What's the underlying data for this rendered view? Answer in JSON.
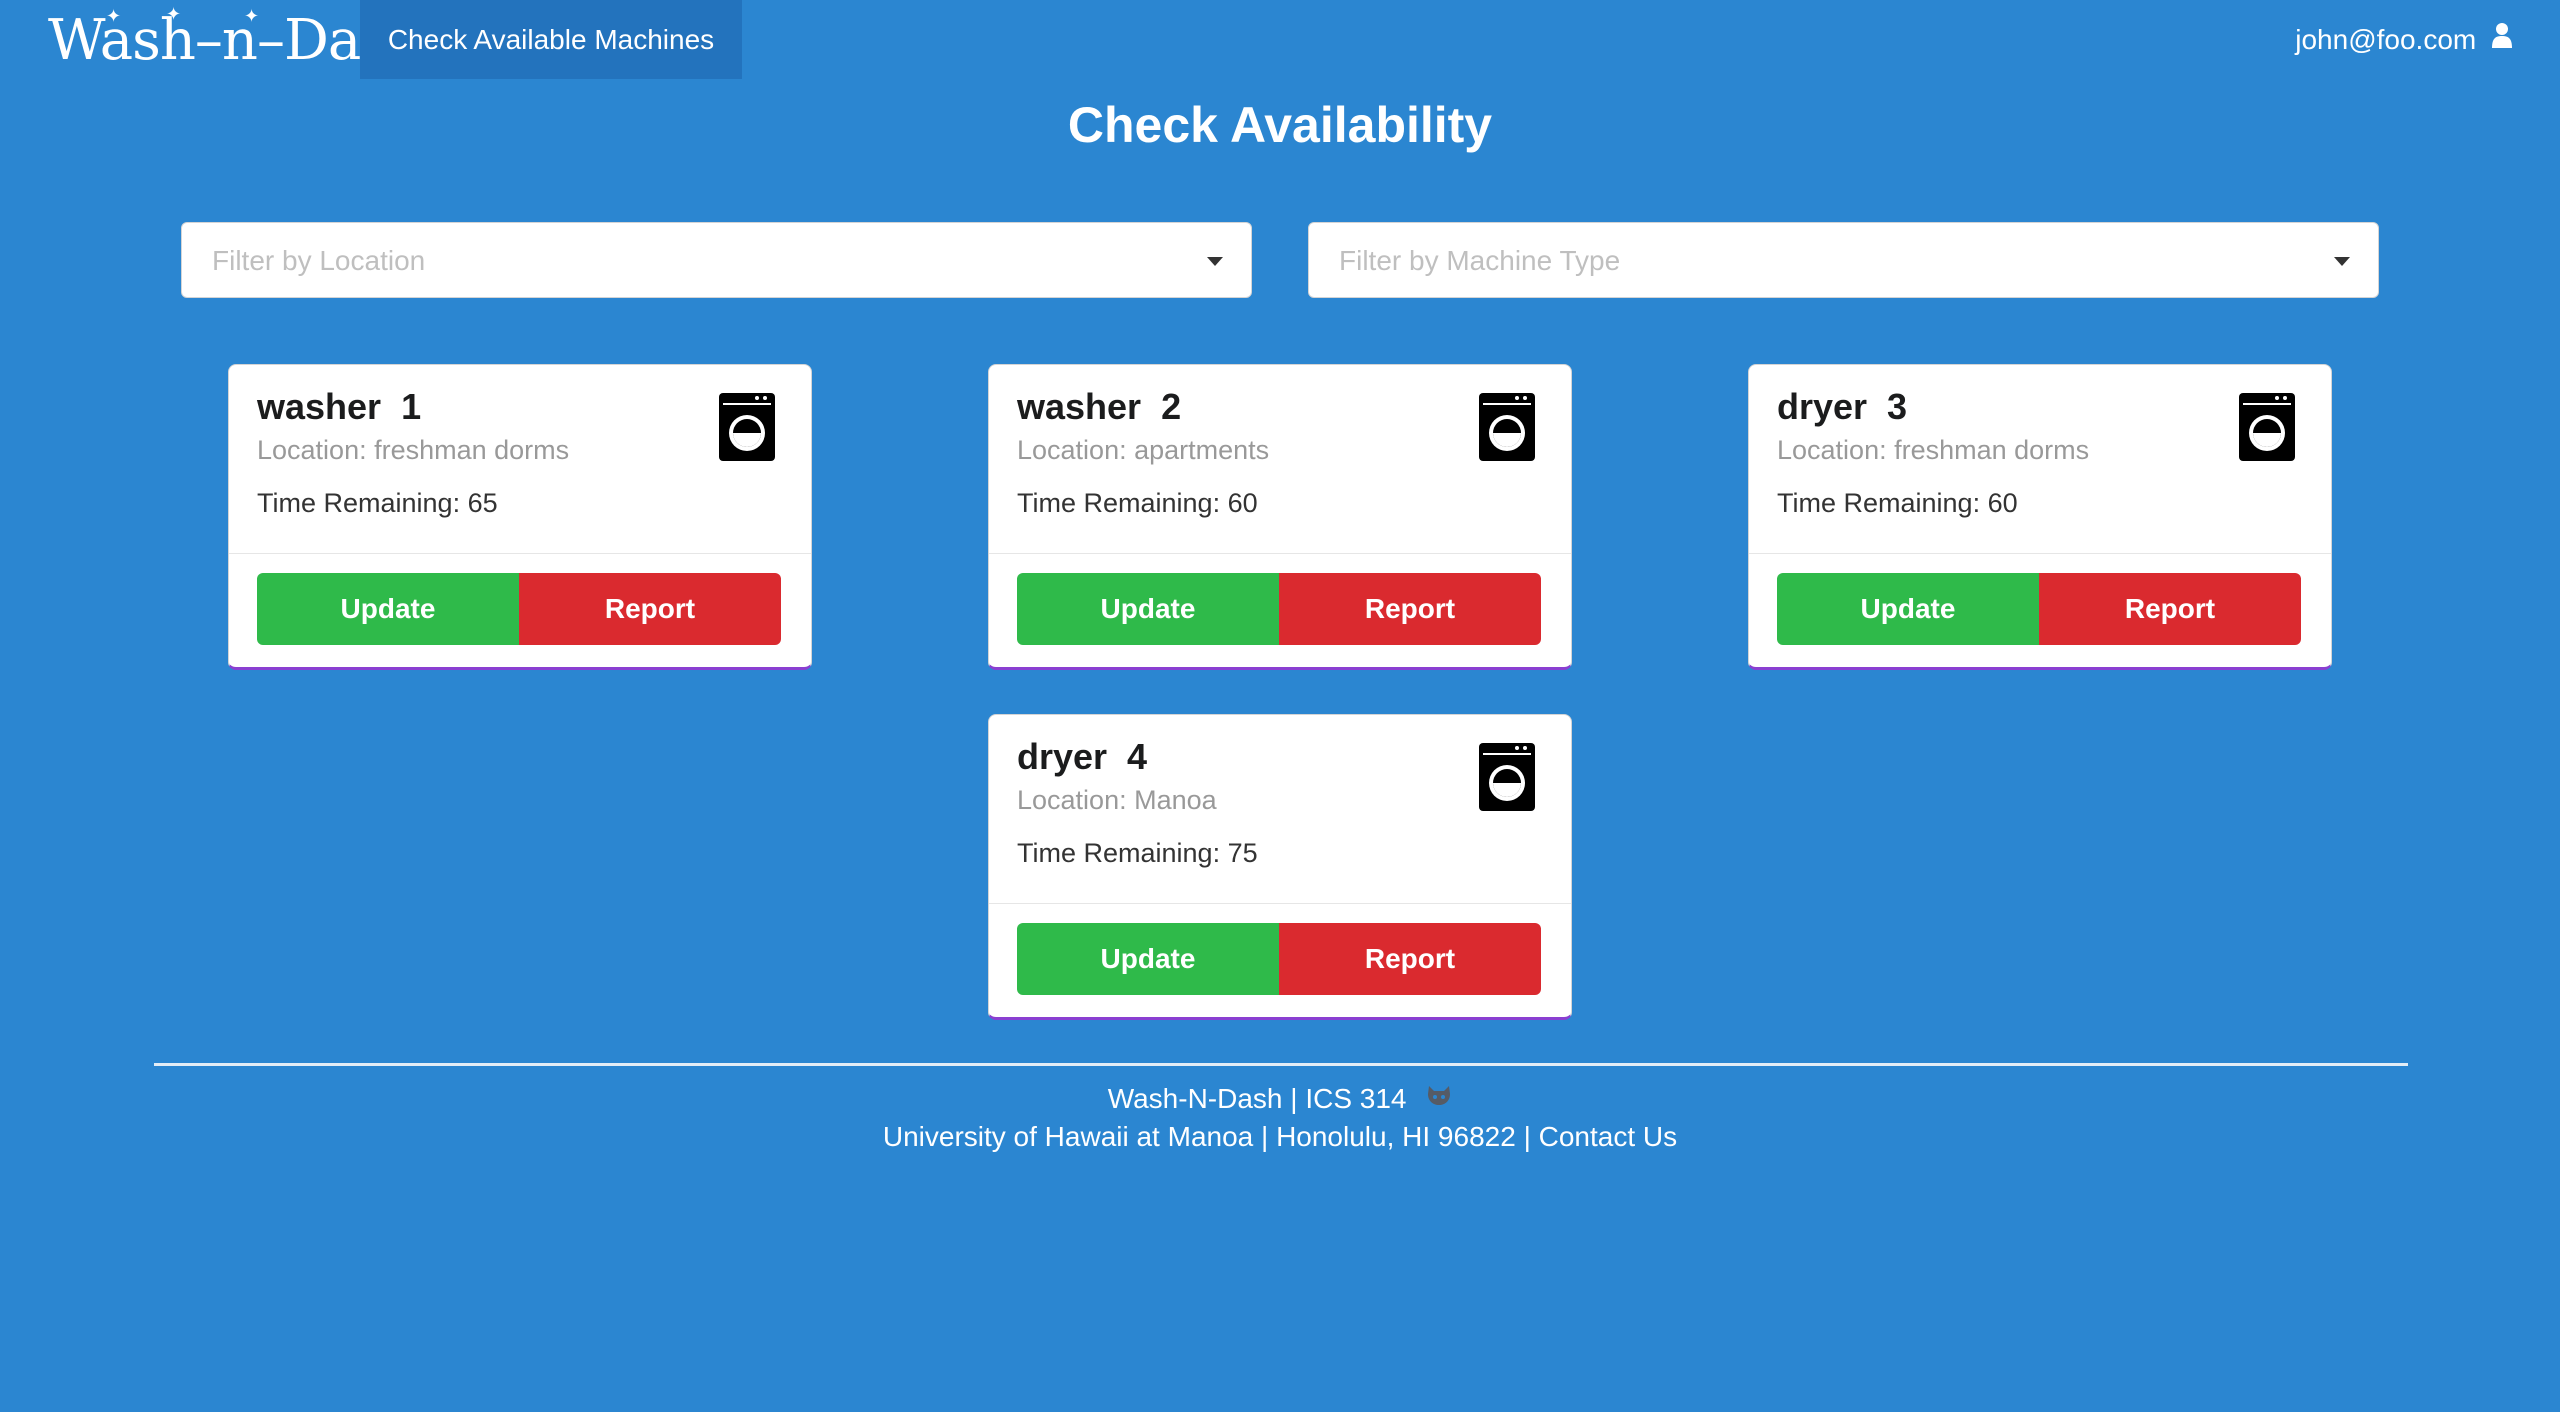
{
  "app": {
    "logo_text": "Wash–n–Dash",
    "nav_tab_label": "Check Available Machines",
    "user_email": "john@foo.com",
    "user_icon": "user-icon"
  },
  "page": {
    "title": "Check Availability"
  },
  "filters": {
    "location": {
      "placeholder": "Filter by Location",
      "icon": "caret-down-icon"
    },
    "machine_type": {
      "placeholder": "Filter by Machine Type",
      "icon": "caret-down-icon"
    }
  },
  "machines": [
    {
      "name": "washer  1",
      "location": "Location: freshman dorms",
      "time_remaining": "Time Remaining: 65",
      "icon": "washing-machine-icon",
      "update_label": "Update",
      "report_label": "Report"
    },
    {
      "name": "washer  2",
      "location": "Location: apartments",
      "time_remaining": "Time Remaining: 60",
      "icon": "washing-machine-icon",
      "update_label": "Update",
      "report_label": "Report"
    },
    {
      "name": "dryer  3",
      "location": "Location: freshman dorms",
      "time_remaining": "Time Remaining: 60",
      "icon": "washing-machine-icon",
      "update_label": "Update",
      "report_label": "Report"
    },
    {
      "name": "dryer  4",
      "location": "Location: Manoa",
      "time_remaining": "Time Remaining: 75",
      "icon": "washing-machine-icon",
      "update_label": "Update",
      "report_label": "Report"
    }
  ],
  "footer": {
    "line1": "Wash-N-Dash | ICS 314",
    "github_icon": "github-icon",
    "line2_prefix": "University of Hawaii at Manoa | Honolulu, HI 96822 | ",
    "contact_link": "Contact Us"
  },
  "colors": {
    "background": "#2b86d1",
    "nav_active": "#2373bd",
    "update_button": "#2fba4a",
    "report_button": "#da2a2f",
    "card_bottom_border": "#8a3fd1"
  }
}
